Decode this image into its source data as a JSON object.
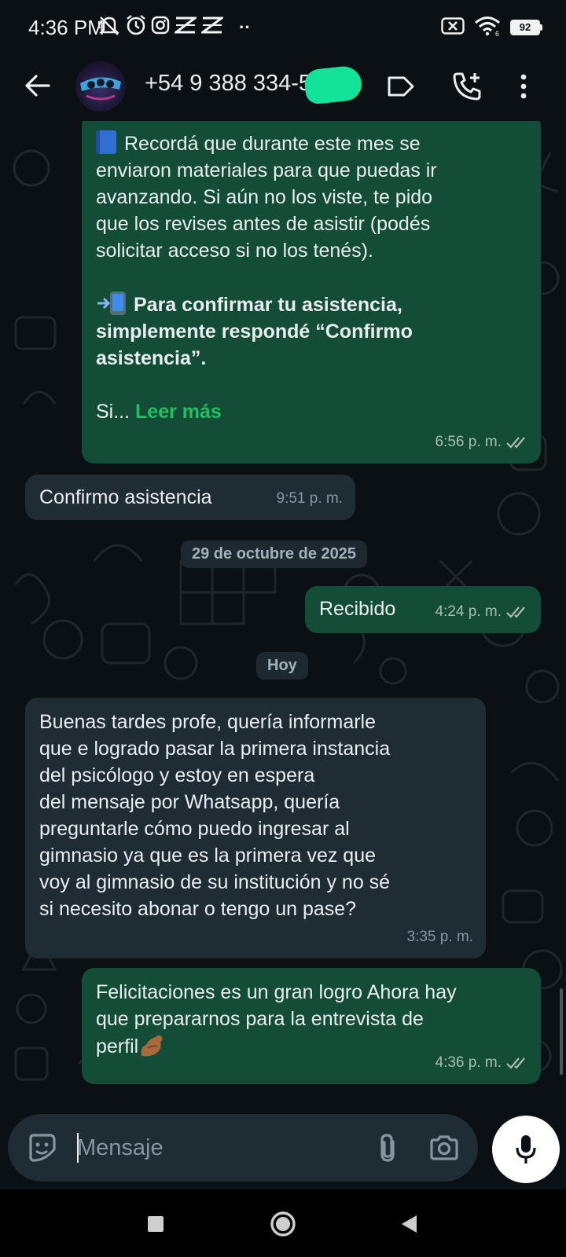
{
  "status_bar": {
    "time": "4:36 PM",
    "notification_icons": [
      "mute-icon",
      "alarm-icon",
      "instagram-icon",
      "capcut-icon",
      "capcut-icon"
    ],
    "more_dots": "··",
    "battery_level": "92"
  },
  "header": {
    "contact_name": "+54 9 388 334-",
    "contact_name_suffix": "56"
  },
  "messages": [
    {
      "direction": "out",
      "line1": "Recordá que durante este mes se",
      "line2": "enviaron materiales para que puedas ir",
      "line3": "avanzando. Si aún no los viste, te pido",
      "line4": "que los revises antes de asistir (podés",
      "line5": "solicitar acceso si no los tenés).",
      "bold1": "Para confirmar tu asistencia,",
      "bold2": "simplemente respondé “Confirmo",
      "bold3": "asistencia”.",
      "truncated": "Si...",
      "read_more": "Leer más",
      "time": "6:56 p. m.",
      "status": "read"
    },
    {
      "direction": "in",
      "text": "Confirmo asistencia",
      "time": "9:51 p. m."
    },
    {
      "direction": "out",
      "text": "Recibido",
      "time": "4:24 p. m.",
      "status": "read"
    },
    {
      "direction": "in",
      "text": "Buenas tardes profe, quería informarle\nque e logrado pasar la primera instancia\ndel psicólogo y estoy en espera\ndel mensaje por Whatsapp, quería\npreguntarle cómo puedo ingresar al\ngimnasio ya que es la primera vez que\nvoy al gimnasio de su institución y no sé\nsi necesito abonar o tengo un pase?",
      "time": "3:35 p. m."
    },
    {
      "direction": "out",
      "text": "Felicitaciones es un gran logro Ahora hay\nque prepararnos para la entrevista de\nperfil",
      "time": "4:36 p. m.",
      "status": "read"
    }
  ],
  "date_separators": [
    "29 de octubre de 2025",
    "Hoy"
  ],
  "composer": {
    "placeholder": "Mensaje"
  },
  "colors": {
    "background": "#0b1014",
    "outgoing_bubble": "#134d37",
    "incoming_bubble": "#1f2c34",
    "read_more": "#21c063",
    "redaction": "#12e29a"
  }
}
